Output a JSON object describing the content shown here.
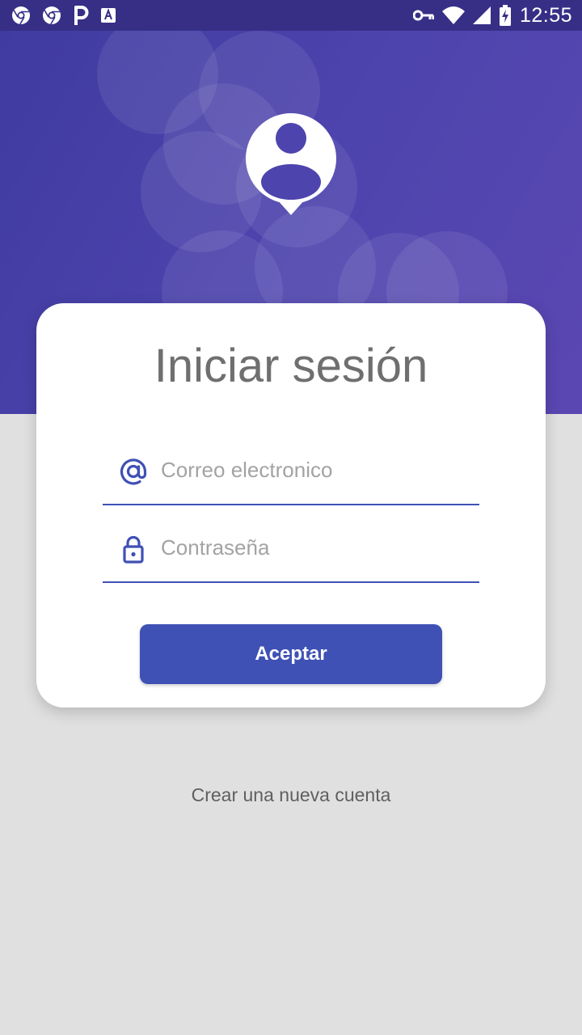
{
  "status_bar": {
    "time": "12:55",
    "left_icons": [
      "chrome-icon",
      "chrome-icon",
      "parking-app-icon",
      "keyboard-app-icon"
    ],
    "right_icons": [
      "vpn-key-icon",
      "wifi-icon",
      "signal-icon",
      "battery-charging-icon"
    ]
  },
  "header": {
    "avatar_icon": "user-pin-icon",
    "background_color": "#4d44ad"
  },
  "login_card": {
    "title": "Iniciar sesión",
    "email_field": {
      "icon": "at-sign-icon",
      "placeholder": "Correo electronico",
      "value": ""
    },
    "password_field": {
      "icon": "lock-icon",
      "placeholder": "Contraseña",
      "value": ""
    },
    "accept_label": "Aceptar"
  },
  "footer": {
    "create_account_label": "Crear una nueva cuenta"
  },
  "colors": {
    "accent": "#3f51b5",
    "status_bar": "#372f86",
    "page_background": "#e0e0e0"
  }
}
